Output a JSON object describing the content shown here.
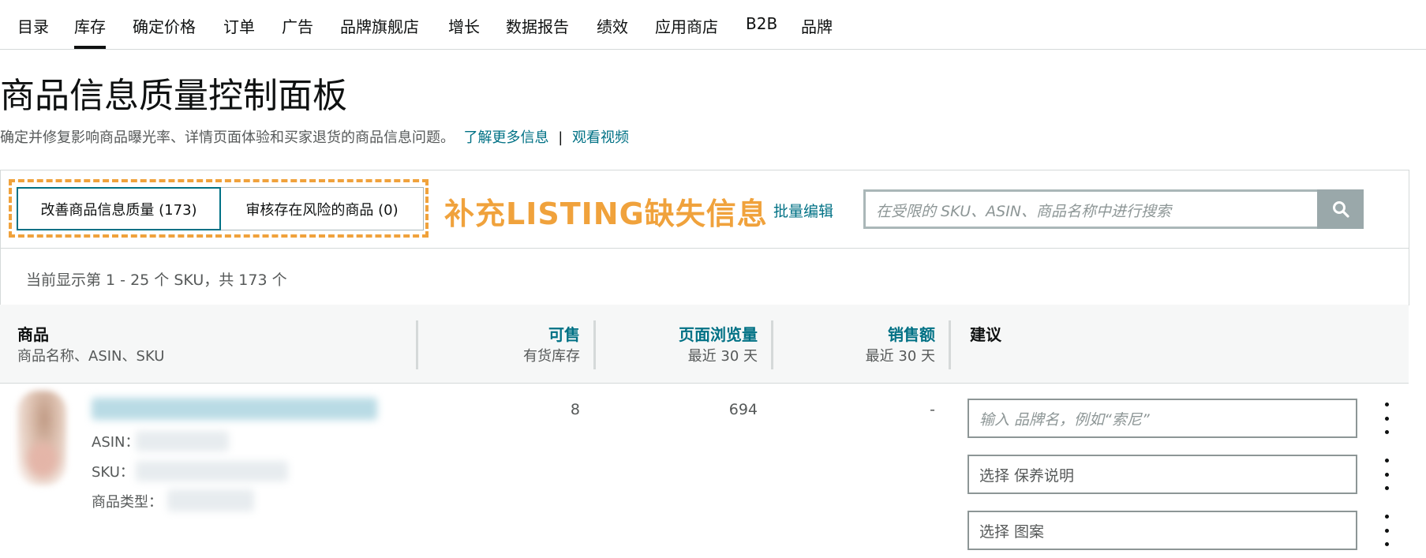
{
  "nav": {
    "items": [
      {
        "label": "目录"
      },
      {
        "label": "库存",
        "active": true
      },
      {
        "label": "确定价格"
      },
      {
        "label": "订单"
      },
      {
        "label": "广告"
      },
      {
        "label": "品牌旗舰店"
      },
      {
        "label": "增长"
      },
      {
        "label": "数据报告"
      },
      {
        "label": "绩效"
      },
      {
        "label": "应用商店"
      },
      {
        "label": "B2B"
      },
      {
        "label": "品牌"
      }
    ]
  },
  "page": {
    "title": "商品信息质量控制面板",
    "subtitle": "确定并修复影响商品曝光率、详情页面体验和买家退货的商品信息问题。",
    "learn_more": "了解更多信息",
    "separator": "|",
    "watch_video": "观看视频"
  },
  "tabs": [
    {
      "label": "改善商品信息质量 (173)",
      "selected": true
    },
    {
      "label": "审核存在风险的商品 (0)",
      "selected": false
    }
  ],
  "annotation": "补充LISTING缺失信息",
  "bulk_edit": "批量编辑",
  "search": {
    "placeholder": "在受限的 SKU、ASIN、商品名称中进行搜索",
    "icon": "search-icon"
  },
  "result_count": "当前显示第 1 - 25 个 SKU，共 173 个",
  "columns": [
    {
      "title": "商品",
      "sub": "商品名称、ASIN、SKU"
    },
    {
      "title": "可售",
      "sub": "有货库存"
    },
    {
      "title": "页面浏览量",
      "sub": "最近 30 天"
    },
    {
      "title": "销售额",
      "sub": "最近 30 天"
    },
    {
      "title": "建议",
      "sub": ""
    }
  ],
  "row": {
    "asin_label": "ASIN：",
    "sku_label": "SKU：",
    "type_label": "商品类型：",
    "available": "8",
    "page_views": "694",
    "sales": "-",
    "suggestions": [
      {
        "text": "输入 品牌名，例如“索尼”",
        "kind": "placeholder"
      },
      {
        "text": "选择 保养说明",
        "kind": "select"
      },
      {
        "text": "选择 图案",
        "kind": "select"
      }
    ]
  },
  "colors": {
    "accent": "#007185",
    "annotation": "#f0a23c",
    "text": "#0f1111",
    "muted": "#565959"
  }
}
